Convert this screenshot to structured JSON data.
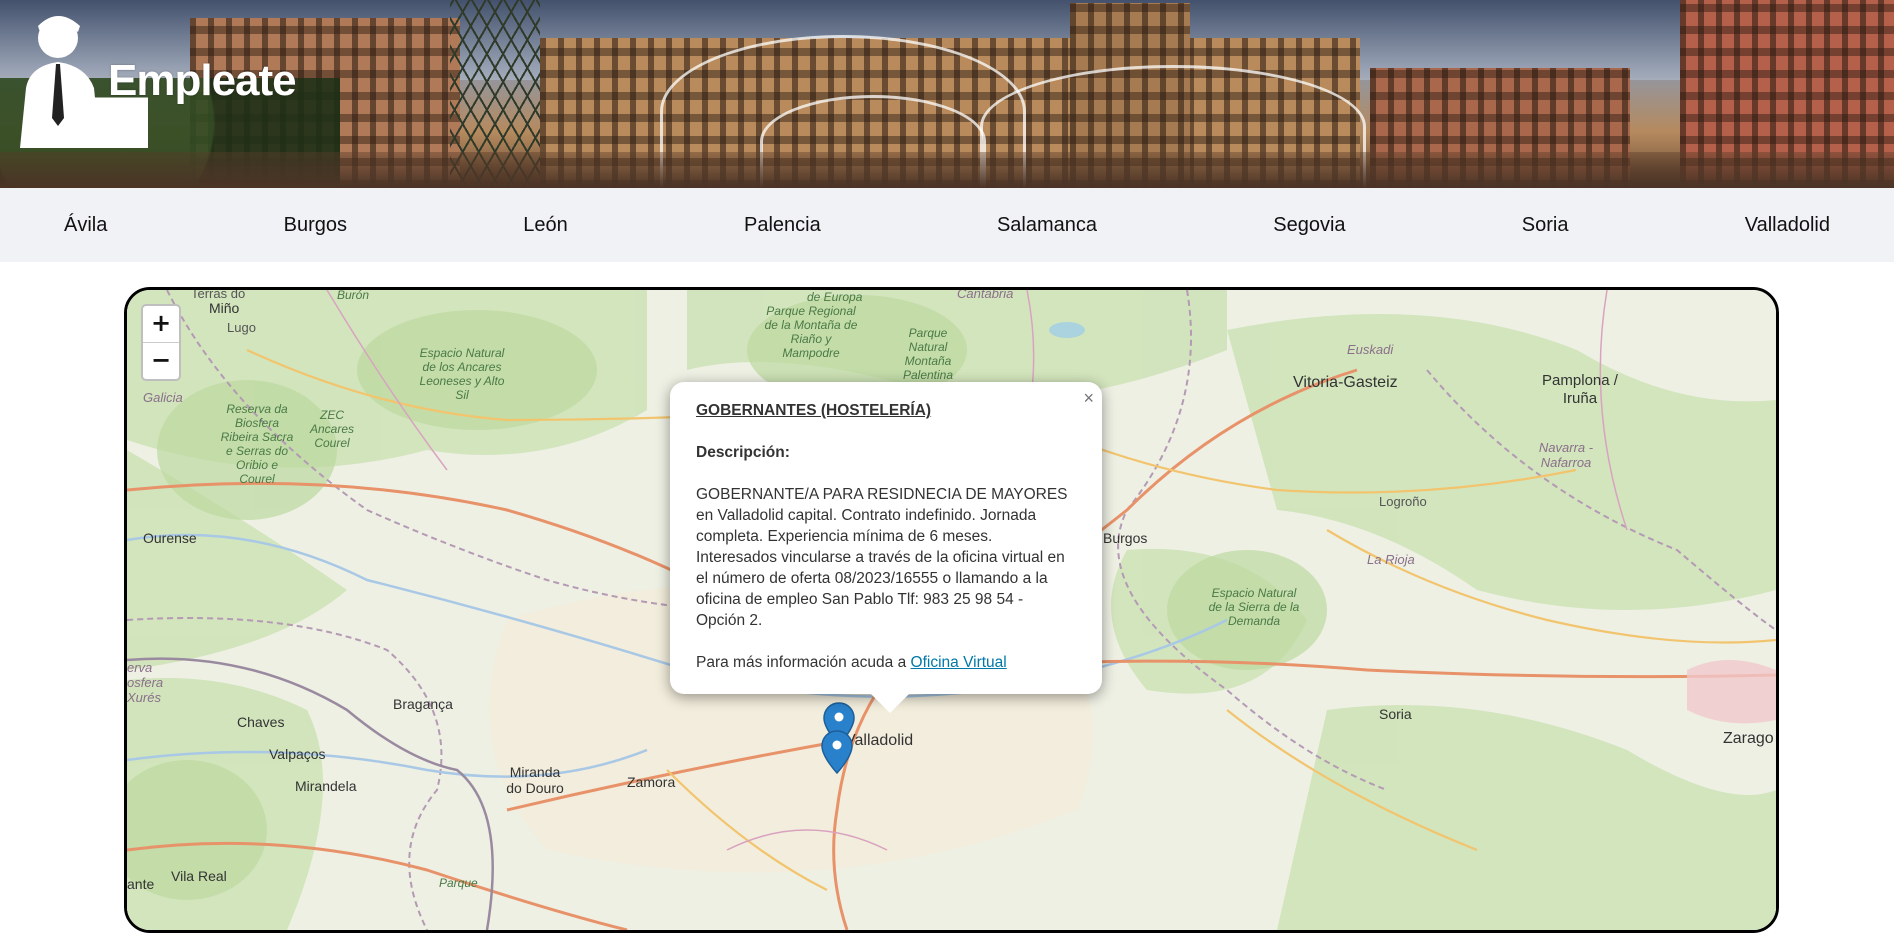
{
  "header": {
    "brand": "Empleate"
  },
  "nav": {
    "items": [
      "Ávila",
      "Burgos",
      "León",
      "Palencia",
      "Salamanca",
      "Segovia",
      "Soria",
      "Valladolid"
    ]
  },
  "map": {
    "zoom_in": "+",
    "zoom_out": "−",
    "labels": {
      "lugo": "Lugo",
      "miño": "Miño",
      "terras": "Terras do",
      "galicia": "Galicia",
      "reserva": "Reserva da Biosfera Ribeira Sacra e Serras do Oribio e Courel",
      "zec": "ZEC Ancares Courel",
      "espacio_ancares": "Espacio Natural de los Ancares Leoneses y Alto Sil",
      "buron": "Burón",
      "europa": "de Europa",
      "cantabria": "Cantabria",
      "parque_regional": "Parque Regional de la Montaña de Riaño y Mampodre",
      "parque_natural": "Parque Natural Montaña Palentina",
      "euskadi": "Euskadi",
      "vitoria": "Vitoria-Gasteiz",
      "pamplona": "Pamplona / Iruña",
      "navarra": "Navarra - Nafarroa",
      "logrono": "Logroño",
      "rioja": "La Rioja",
      "burgos": "Burgos",
      "espacio_demanda": "Espacio Natural de la Sierra de la Demanda",
      "ourense": "Ourense",
      "braganca": "Bragança",
      "chaves": "Chaves",
      "valpacos": "Valpaços",
      "mirandela": "Mirandela",
      "miranda": "Miranda do Douro",
      "zamora": "Zamora",
      "valladolid": "Valladolid",
      "soria": "Soria",
      "zaragoza": "Zarago",
      "xures": "erva osfera Xurés",
      "vila_real": "Vila Real",
      "ante": "ante",
      "parque_b": "Parque"
    }
  },
  "popup": {
    "close": "×",
    "title": "GOBERNANTES (HOSTELERÍA)",
    "desc_label": "Descripción:",
    "description": "GOBERNANTE/A PARA RESIDNECIA DE MAYORES en Valladolid capital. Contrato indefinido. Jornada completa. Experiencia mínima de 6 meses. Interesados vincularse a través de la oficina virtual en el número de oferta 08/2023/16555 o llamando a la oficina de empleo San Pablo Tlf: 983 25 98 54 - Opción 2.",
    "more_info": "Para más información acuda a ",
    "link": "Oficina Virtual"
  },
  "colors": {
    "marker": "#2a81cb",
    "link": "#0078a8",
    "nav_bg": "#f1f2f6"
  },
  "markers": [
    "marker-icon",
    "marker-icon",
    "marker-icon"
  ]
}
